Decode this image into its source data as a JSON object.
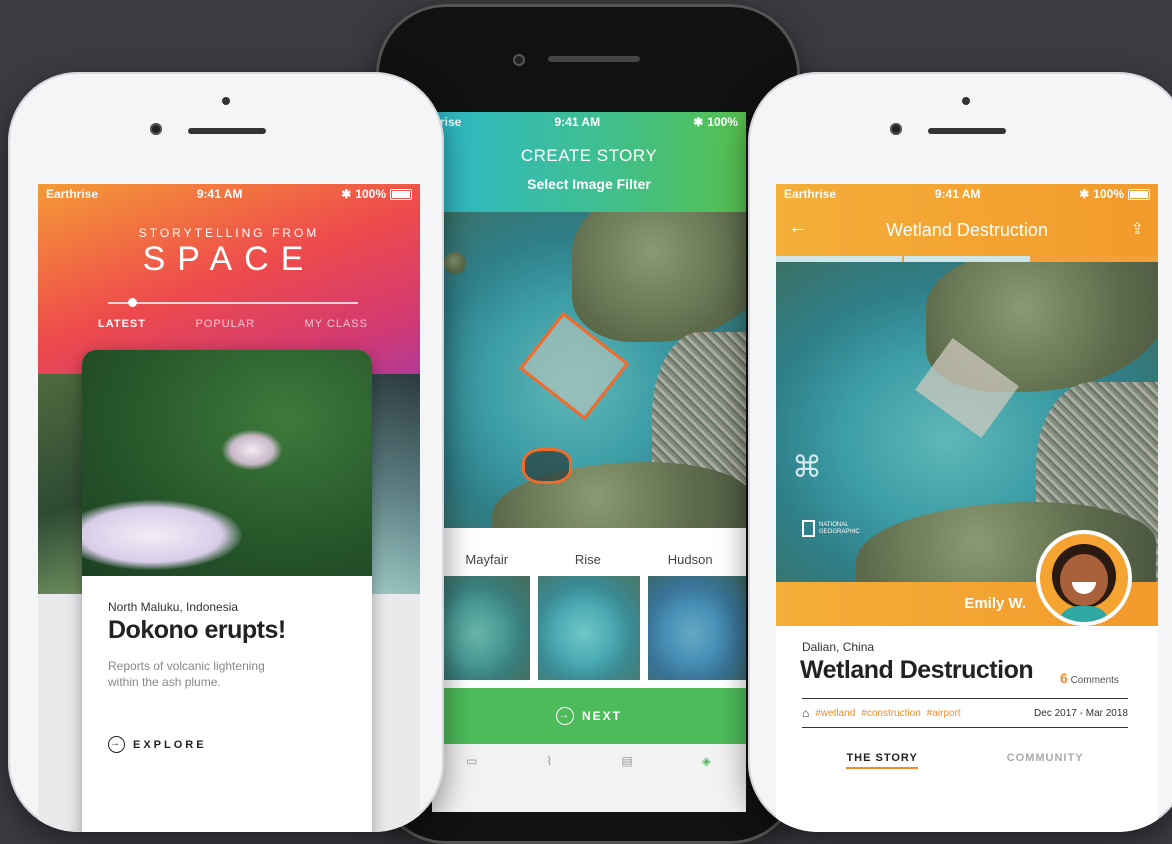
{
  "left_phone": {
    "status": {
      "carrier": "Earthrise",
      "time": "9:41 AM",
      "battery": "100%"
    },
    "header": {
      "line1": "STORYTELLING FROM",
      "line2": "SPACE"
    },
    "tabs": [
      {
        "label": "LATEST"
      },
      {
        "label": "POPULAR"
      },
      {
        "label": "MY CLASS"
      }
    ],
    "card": {
      "location": "North Maluku, Indonesia",
      "title": "Dokono erupts!",
      "desc": "Reports of volcanic lightening within the ash plume.",
      "explore": "EXPLORE"
    }
  },
  "center_phone": {
    "status": {
      "carrier": "rise",
      "time": "9:41 AM",
      "battery": "100%"
    },
    "header": {
      "title": "CREATE STORY",
      "subtitle": "Select Image Filter"
    },
    "filters": [
      {
        "label": "Mayfair"
      },
      {
        "label": "Rise"
      },
      {
        "label": "Hudson"
      }
    ],
    "next_label": "NEXT"
  },
  "right_phone": {
    "status": {
      "carrier": "Earthrise",
      "time": "9:41 AM",
      "battery": "100%"
    },
    "nav_title": "Wetland Destruction",
    "watermark": "NATIONAL GEOGRAPHIC",
    "author": "Emily W.",
    "location": "Dalian, China",
    "title": "Wetland Destruction",
    "comments_count": "6",
    "comments_label": "Comments",
    "tags": [
      "#wetland",
      "#construction",
      "#airport"
    ],
    "date_range": "Dec 2017 - Mar 2018",
    "tabs": [
      {
        "label": "THE STORY"
      },
      {
        "label": "COMMUNITY"
      }
    ]
  },
  "colors": {
    "orange": "#f28c28",
    "green": "#4dbb5a",
    "teal": "#29b6c9",
    "pink": "#e8365f"
  }
}
